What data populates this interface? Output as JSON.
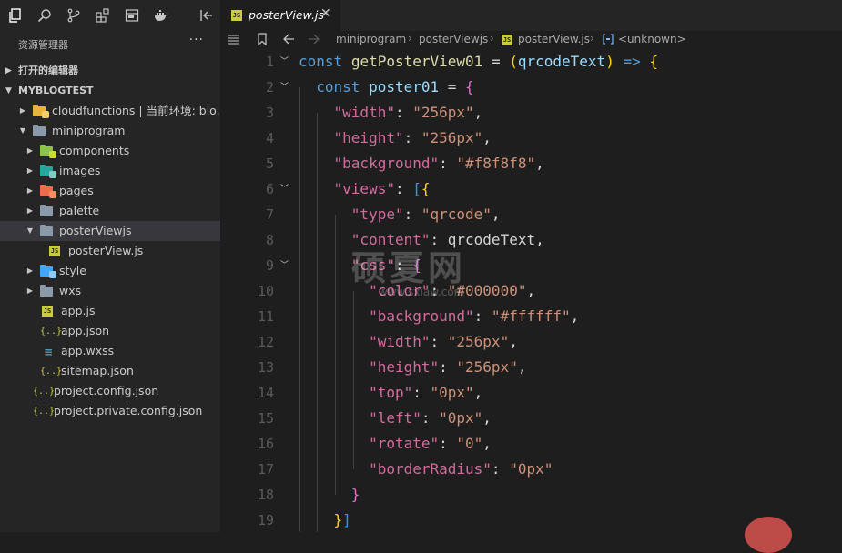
{
  "activity_toolbar": {
    "icons": [
      "explorer-icon",
      "search-icon",
      "source-control-icon",
      "extensions-icon",
      "remote-icon",
      "docker-icon",
      "collapse-panel-icon"
    ]
  },
  "sidebar": {
    "title": "资源管理器",
    "more": "···",
    "open_editors_label": "打开的编辑器",
    "project_label": "MYBLOGTEST",
    "tree": [
      {
        "label": "cloudfunctions | 当前环境: blo...",
        "type": "folder-cloud",
        "depth": 1,
        "expanded": false
      },
      {
        "label": "miniprogram",
        "type": "folder",
        "depth": 1,
        "expanded": true
      },
      {
        "label": "components",
        "type": "folder-components",
        "depth": 2,
        "expanded": false
      },
      {
        "label": "images",
        "type": "folder-images",
        "depth": 2,
        "expanded": false
      },
      {
        "label": "pages",
        "type": "folder-pages",
        "depth": 2,
        "expanded": false
      },
      {
        "label": "palette",
        "type": "folder",
        "depth": 2,
        "expanded": false
      },
      {
        "label": "posterViewjs",
        "type": "folder",
        "depth": 2,
        "expanded": true,
        "selected": true
      },
      {
        "label": "posterView.js",
        "type": "js",
        "depth": 3
      },
      {
        "label": "style",
        "type": "folder-style",
        "depth": 2,
        "expanded": false
      },
      {
        "label": "wxs",
        "type": "folder",
        "depth": 2,
        "expanded": false
      },
      {
        "label": "app.js",
        "type": "js",
        "depth": 2
      },
      {
        "label": "app.json",
        "type": "json",
        "depth": 2
      },
      {
        "label": "app.wxss",
        "type": "css",
        "depth": 2
      },
      {
        "label": "sitemap.json",
        "type": "json",
        "depth": 2
      },
      {
        "label": "project.config.json",
        "type": "json",
        "depth": 1
      },
      {
        "label": "project.private.config.json",
        "type": "json",
        "depth": 1
      }
    ]
  },
  "editor": {
    "tab": {
      "label": "posterView.js",
      "close": "✕",
      "icon_text": "JS"
    },
    "breadcrumb": [
      "miniprogram",
      "posterViewjs",
      "posterView.js",
      "<unknown>"
    ],
    "breadcrumb_sep": "›",
    "lines": [
      {
        "n": "1",
        "fold": true
      },
      {
        "n": "2",
        "fold": true
      },
      {
        "n": "3"
      },
      {
        "n": "4"
      },
      {
        "n": "5"
      },
      {
        "n": "6",
        "fold": true
      },
      {
        "n": "7"
      },
      {
        "n": "8"
      },
      {
        "n": "9",
        "fold": true
      },
      {
        "n": "10"
      },
      {
        "n": "11"
      },
      {
        "n": "12"
      },
      {
        "n": "13"
      },
      {
        "n": "14"
      },
      {
        "n": "15"
      },
      {
        "n": "16"
      },
      {
        "n": "17"
      },
      {
        "n": "18"
      },
      {
        "n": "19"
      }
    ],
    "code": {
      "l1": {
        "kw": "const",
        "fn": "getPosterView01",
        "eq": " = ",
        "p1": "(",
        "param": "qrcodeText",
        "p2": ")",
        "arrow": " => ",
        "brace": "{"
      },
      "l2": {
        "kw": "const",
        "var": "poster01",
        "eq": " = ",
        "brace": "{"
      },
      "l3": {
        "key": "\"width\"",
        "colon": ": ",
        "val": "\"256px\"",
        "comma": ","
      },
      "l4": {
        "key": "\"height\"",
        "colon": ": ",
        "val": "\"256px\"",
        "comma": ","
      },
      "l5": {
        "key": "\"background\"",
        "colon": ": ",
        "val": "\"#f8f8f8\"",
        "comma": ","
      },
      "l6": {
        "key": "\"views\"",
        "colon": ": ",
        "b1": "[",
        "b2": "{"
      },
      "l7": {
        "key": "\"type\"",
        "colon": ": ",
        "val": "\"qrcode\"",
        "comma": ","
      },
      "l8": {
        "key": "\"content\"",
        "colon": ": ",
        "val": "qrcodeText",
        "comma": ","
      },
      "l9": {
        "key": "\"css\"",
        "colon": ": ",
        "brace": "{"
      },
      "l10": {
        "key": "\"color\"",
        "colon": ": ",
        "val": "\"#000000\"",
        "comma": ","
      },
      "l11": {
        "key": "\"background\"",
        "colon": ": ",
        "val": "\"#ffffff\"",
        "comma": ","
      },
      "l12": {
        "key": "\"width\"",
        "colon": ": ",
        "val": "\"256px\"",
        "comma": ","
      },
      "l13": {
        "key": "\"height\"",
        "colon": ": ",
        "val": "\"256px\"",
        "comma": ","
      },
      "l14": {
        "key": "\"top\"",
        "colon": ": ",
        "val": "\"0px\"",
        "comma": ","
      },
      "l15": {
        "key": "\"left\"",
        "colon": ": ",
        "val": "\"0px\"",
        "comma": ","
      },
      "l16": {
        "key": "\"rotate\"",
        "colon": ": ",
        "val": "\"0\"",
        "comma": ","
      },
      "l17": {
        "key": "\"borderRadius\"",
        "colon": ": ",
        "val": "\"0px\""
      },
      "l18": {
        "brace": "}"
      },
      "l19": {
        "b1": "}",
        "b2": "]"
      }
    }
  },
  "watermark": {
    "main": "硕夏网",
    "sub": "www.sxiaw.com"
  },
  "colors": {
    "keyword": "#569cd6",
    "function": "#dcdcaa",
    "string": "#ce9178",
    "key": "#d16d9e",
    "variable": "#9cdcfe",
    "bg": "#1e1e1e",
    "sidebar": "#252526"
  }
}
